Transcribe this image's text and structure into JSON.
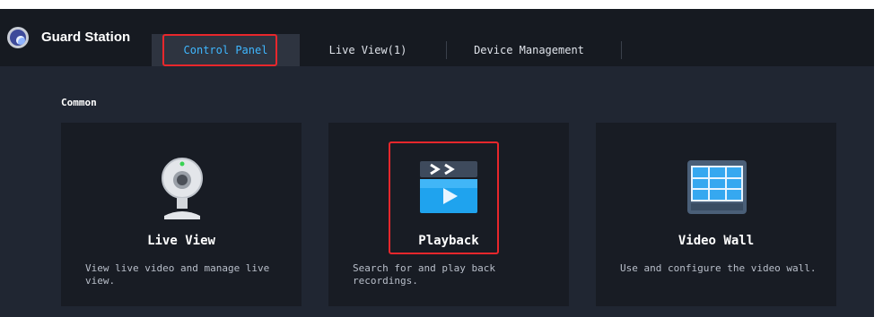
{
  "app": {
    "title": "Guard Station"
  },
  "tabs": [
    {
      "label": "Control Panel",
      "active": true
    },
    {
      "label": "Live View(1)",
      "active": false
    },
    {
      "label": "Device Management",
      "active": false
    }
  ],
  "section": {
    "title": "Common"
  },
  "cards": [
    {
      "title": "Live View",
      "description": "View live video and manage live view.",
      "icon": "webcam-icon"
    },
    {
      "title": "Playback",
      "description": "Search for and play back recordings.",
      "icon": "clapperboard-play-icon"
    },
    {
      "title": "Video Wall",
      "description": "Use and configure the video wall.",
      "icon": "video-wall-icon"
    }
  ],
  "colors": {
    "accent": "#3fb7ff",
    "highlight": "#e8272c",
    "titlebar_bg": "#161a21",
    "content_bg": "#202632",
    "card_bg": "#181c24"
  }
}
